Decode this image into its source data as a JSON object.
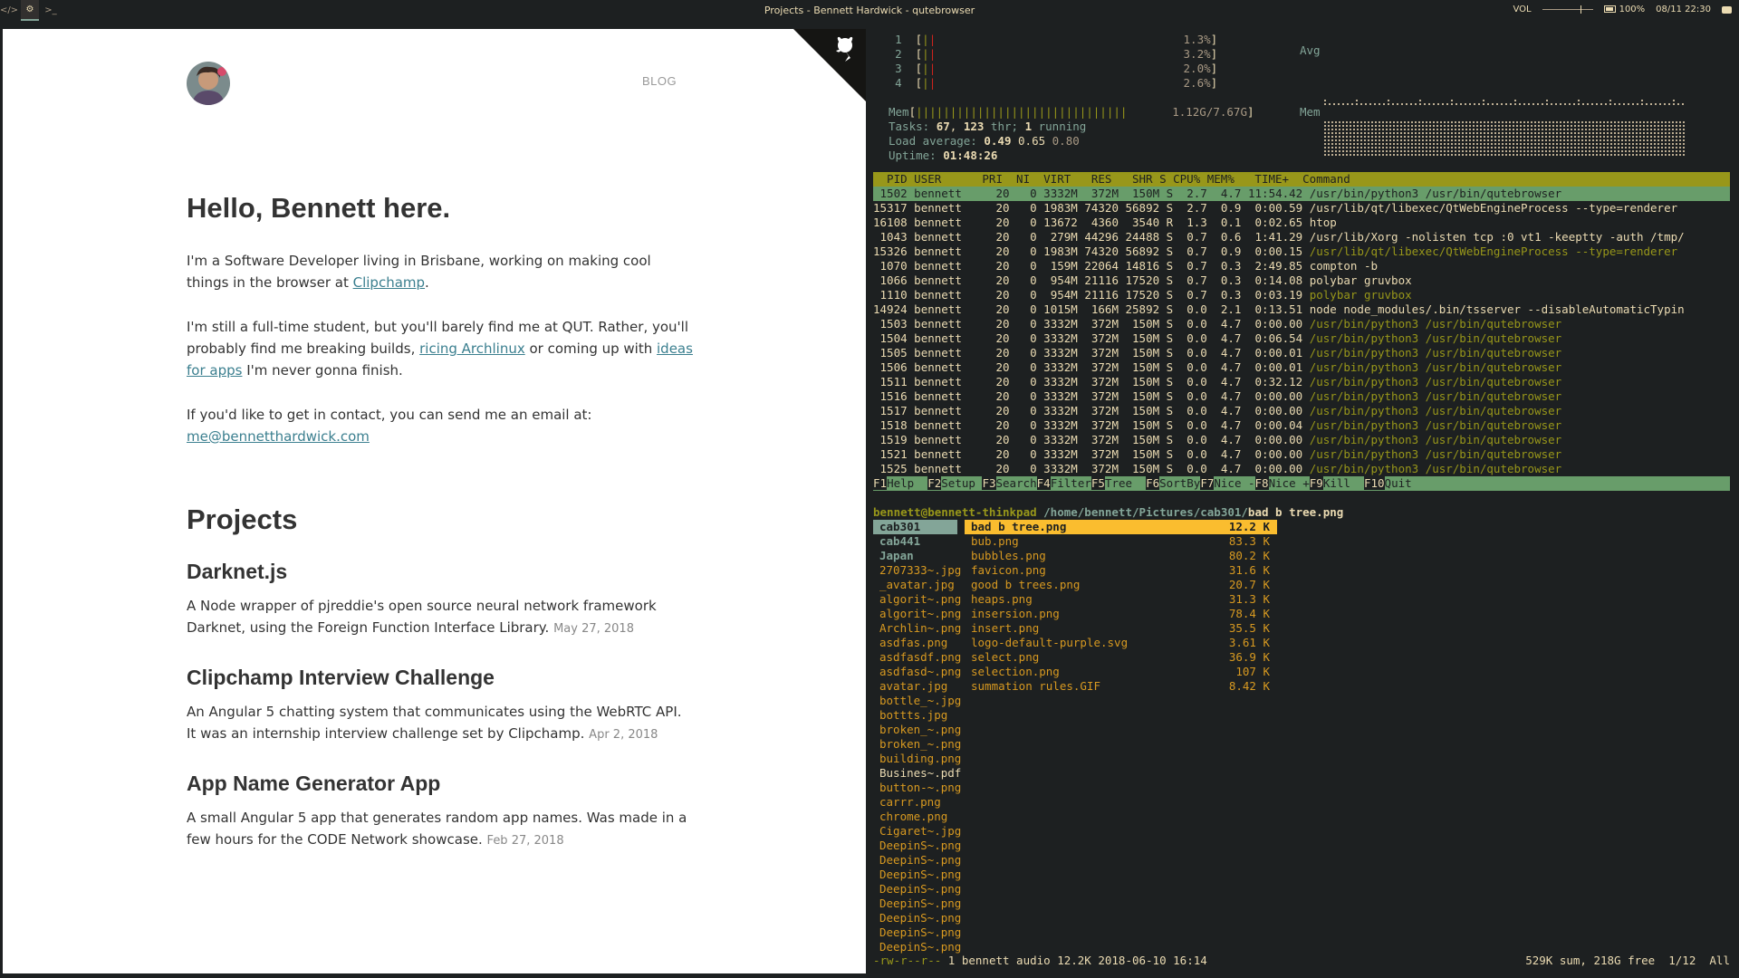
{
  "topbar": {
    "workspaces": [
      "</>",
      "⚙",
      ">_"
    ],
    "window_title": "Projects - Bennett Hardwick - qutebrowser",
    "volume_label": "VOL",
    "volume_level": 0.75,
    "battery": "100%",
    "datetime": "08/11 22:30"
  },
  "browser": {
    "nav_blog": "BLOG",
    "heading": "Hello, Bennett here.",
    "intro_1a": "I'm a Software Developer living in Brisbane, working on making cool things in the browser at ",
    "intro_1_link": "Clipchamp",
    "intro_1b": ".",
    "intro_2a": "I'm still a full-time student, but you'll barely find me at QUT. Rather, you'll probably find me breaking builds, ",
    "intro_2_link1": "ricing Archlinux",
    "intro_2b": " or coming up with ",
    "intro_2_link2": "ideas for apps",
    "intro_2c": " I'm never gonna finish.",
    "contact_text": "If you'd like to get in contact, you can send me an email at:",
    "contact_email": "me@bennetthardwick.com",
    "projects_heading": "Projects",
    "projects": [
      {
        "title": "Darknet.js",
        "desc": "A Node wrapper of pjreddie's open source neural network framework Darknet, using the Foreign Function Interface Library.",
        "date": "May 27, 2018"
      },
      {
        "title": "Clipchamp Interview Challenge",
        "desc": "An Angular 5 chatting system that communicates using the WebRTC API. It was an internship interview challenge set by Clipchamp.",
        "date": "Apr 2, 2018"
      },
      {
        "title": "App Name Generator App",
        "desc": "A small Angular 5 app that generates random app names. Was made in a few hours for the CODE Network showcase.",
        "date": "Feb 27, 2018"
      }
    ]
  },
  "htop": {
    "cpus": [
      {
        "id": "1",
        "pct": "1.3%"
      },
      {
        "id": "2",
        "pct": "3.2%"
      },
      {
        "id": "3",
        "pct": "2.0%"
      },
      {
        "id": "4",
        "pct": "2.6%"
      }
    ],
    "mem_label": "Mem",
    "mem_value": "1.12G/7.67G",
    "avg_label": "Avg",
    "mem_graph_label": "Mem",
    "tasks_label": "Tasks:",
    "tasks_count": "67",
    "tasks_thr": "123",
    "tasks_thr_label": "thr;",
    "tasks_running": "1",
    "tasks_running_label": "running",
    "load_label": "Load average:",
    "load_1": "0.49",
    "load_5": "0.65",
    "load_15": "0.80",
    "uptime_label": "Uptime:",
    "uptime": "01:48:26",
    "header": "  PID USER      PRI  NI  VIRT   RES   SHR S CPU% MEM%   TIME+  Command",
    "rows": [
      {
        "pid": "1502",
        "user": "bennett",
        "pri": "20",
        "ni": "0",
        "virt": "3332M",
        "res": "372M",
        "shr": "150M",
        "s": "S",
        "cpu": "2.7",
        "mem": "4.7",
        "time": "11:54.42",
        "cmd": "/usr/bin/python3 /usr/bin/qutebrowser",
        "sel": true,
        "thread": false
      },
      {
        "pid": "15317",
        "user": "bennett",
        "pri": "20",
        "ni": "0",
        "virt": "1983M",
        "res": "74320",
        "shr": "56892",
        "s": "S",
        "cpu": "2.7",
        "mem": "0.9",
        "time": "0:00.59",
        "cmd": "/usr/lib/qt/libexec/QtWebEngineProcess --type=renderer",
        "sel": false,
        "thread": false
      },
      {
        "pid": "16108",
        "user": "bennett",
        "pri": "20",
        "ni": "0",
        "virt": "13672",
        "res": "4360",
        "shr": "3540",
        "s": "R",
        "cpu": "1.3",
        "mem": "0.1",
        "time": "0:02.65",
        "cmd": "htop",
        "sel": false,
        "thread": false
      },
      {
        "pid": "1043",
        "user": "bennett",
        "pri": "20",
        "ni": "0",
        "virt": "279M",
        "res": "44296",
        "shr": "24488",
        "s": "S",
        "cpu": "0.7",
        "mem": "0.6",
        "time": "1:41.29",
        "cmd": "/usr/lib/Xorg -nolisten tcp :0 vt1 -keeptty -auth /tmp/",
        "sel": false,
        "thread": false
      },
      {
        "pid": "15326",
        "user": "bennett",
        "pri": "20",
        "ni": "0",
        "virt": "1983M",
        "res": "74320",
        "shr": "56892",
        "s": "S",
        "cpu": "0.7",
        "mem": "0.9",
        "time": "0:00.15",
        "cmd": "/usr/lib/qt/libexec/QtWebEngineProcess --type=renderer",
        "sel": false,
        "thread": true
      },
      {
        "pid": "1070",
        "user": "bennett",
        "pri": "20",
        "ni": "0",
        "virt": "159M",
        "res": "22064",
        "shr": "14816",
        "s": "S",
        "cpu": "0.7",
        "mem": "0.3",
        "time": "2:49.85",
        "cmd": "compton -b",
        "sel": false,
        "thread": false
      },
      {
        "pid": "1066",
        "user": "bennett",
        "pri": "20",
        "ni": "0",
        "virt": "954M",
        "res": "21116",
        "shr": "17520",
        "s": "S",
        "cpu": "0.7",
        "mem": "0.3",
        "time": "0:14.08",
        "cmd": "polybar gruvbox",
        "sel": false,
        "thread": false
      },
      {
        "pid": "1110",
        "user": "bennett",
        "pri": "20",
        "ni": "0",
        "virt": "954M",
        "res": "21116",
        "shr": "17520",
        "s": "S",
        "cpu": "0.7",
        "mem": "0.3",
        "time": "0:03.19",
        "cmd": "polybar gruvbox",
        "sel": false,
        "thread": true
      },
      {
        "pid": "14924",
        "user": "bennett",
        "pri": "20",
        "ni": "0",
        "virt": "1015M",
        "res": "166M",
        "shr": "25892",
        "s": "S",
        "cpu": "0.0",
        "mem": "2.1",
        "time": "0:13.51",
        "cmd": "node node_modules/.bin/tsserver --disableAutomaticTypin",
        "sel": false,
        "thread": false
      },
      {
        "pid": "1503",
        "user": "bennett",
        "pri": "20",
        "ni": "0",
        "virt": "3332M",
        "res": "372M",
        "shr": "150M",
        "s": "S",
        "cpu": "0.0",
        "mem": "4.7",
        "time": "0:00.00",
        "cmd": "/usr/bin/python3 /usr/bin/qutebrowser",
        "sel": false,
        "thread": true
      },
      {
        "pid": "1504",
        "user": "bennett",
        "pri": "20",
        "ni": "0",
        "virt": "3332M",
        "res": "372M",
        "shr": "150M",
        "s": "S",
        "cpu": "0.0",
        "mem": "4.7",
        "time": "0:06.54",
        "cmd": "/usr/bin/python3 /usr/bin/qutebrowser",
        "sel": false,
        "thread": true
      },
      {
        "pid": "1505",
        "user": "bennett",
        "pri": "20",
        "ni": "0",
        "virt": "3332M",
        "res": "372M",
        "shr": "150M",
        "s": "S",
        "cpu": "0.0",
        "mem": "4.7",
        "time": "0:00.01",
        "cmd": "/usr/bin/python3 /usr/bin/qutebrowser",
        "sel": false,
        "thread": true
      },
      {
        "pid": "1506",
        "user": "bennett",
        "pri": "20",
        "ni": "0",
        "virt": "3332M",
        "res": "372M",
        "shr": "150M",
        "s": "S",
        "cpu": "0.0",
        "mem": "4.7",
        "time": "0:00.01",
        "cmd": "/usr/bin/python3 /usr/bin/qutebrowser",
        "sel": false,
        "thread": true
      },
      {
        "pid": "1511",
        "user": "bennett",
        "pri": "20",
        "ni": "0",
        "virt": "3332M",
        "res": "372M",
        "shr": "150M",
        "s": "S",
        "cpu": "0.0",
        "mem": "4.7",
        "time": "0:32.12",
        "cmd": "/usr/bin/python3 /usr/bin/qutebrowser",
        "sel": false,
        "thread": true
      },
      {
        "pid": "1516",
        "user": "bennett",
        "pri": "20",
        "ni": "0",
        "virt": "3332M",
        "res": "372M",
        "shr": "150M",
        "s": "S",
        "cpu": "0.0",
        "mem": "4.7",
        "time": "0:00.00",
        "cmd": "/usr/bin/python3 /usr/bin/qutebrowser",
        "sel": false,
        "thread": true
      },
      {
        "pid": "1517",
        "user": "bennett",
        "pri": "20",
        "ni": "0",
        "virt": "3332M",
        "res": "372M",
        "shr": "150M",
        "s": "S",
        "cpu": "0.0",
        "mem": "4.7",
        "time": "0:00.00",
        "cmd": "/usr/bin/python3 /usr/bin/qutebrowser",
        "sel": false,
        "thread": true
      },
      {
        "pid": "1518",
        "user": "bennett",
        "pri": "20",
        "ni": "0",
        "virt": "3332M",
        "res": "372M",
        "shr": "150M",
        "s": "S",
        "cpu": "0.0",
        "mem": "4.7",
        "time": "0:00.04",
        "cmd": "/usr/bin/python3 /usr/bin/qutebrowser",
        "sel": false,
        "thread": true
      },
      {
        "pid": "1519",
        "user": "bennett",
        "pri": "20",
        "ni": "0",
        "virt": "3332M",
        "res": "372M",
        "shr": "150M",
        "s": "S",
        "cpu": "0.0",
        "mem": "4.7",
        "time": "0:00.00",
        "cmd": "/usr/bin/python3 /usr/bin/qutebrowser",
        "sel": false,
        "thread": true
      },
      {
        "pid": "1521",
        "user": "bennett",
        "pri": "20",
        "ni": "0",
        "virt": "3332M",
        "res": "372M",
        "shr": "150M",
        "s": "S",
        "cpu": "0.0",
        "mem": "4.7",
        "time": "0:00.00",
        "cmd": "/usr/bin/python3 /usr/bin/qutebrowser",
        "sel": false,
        "thread": true
      },
      {
        "pid": "1525",
        "user": "bennett",
        "pri": "20",
        "ni": "0",
        "virt": "3332M",
        "res": "372M",
        "shr": "150M",
        "s": "S",
        "cpu": "0.0",
        "mem": "4.7",
        "time": "0:00.00",
        "cmd": "/usr/bin/python3 /usr/bin/qutebrowser",
        "sel": false,
        "thread": true
      }
    ],
    "fkeys": [
      {
        "key": "F1",
        "label": "Help  "
      },
      {
        "key": "F2",
        "label": "Setup "
      },
      {
        "key": "F3",
        "label": "Search"
      },
      {
        "key": "F4",
        "label": "Filter"
      },
      {
        "key": "F5",
        "label": "Tree  "
      },
      {
        "key": "F6",
        "label": "SortBy"
      },
      {
        "key": "F7",
        "label": "Nice -"
      },
      {
        "key": "F8",
        "label": "Nice +"
      },
      {
        "key": "F9",
        "label": "Kill  "
      },
      {
        "key": "F10",
        "label": "Quit  "
      }
    ]
  },
  "ranger": {
    "user_host": "bennett@bennett-thinkpad",
    "path": " /home/bennett/Pictures/cab301/",
    "file": "bad b tree.png",
    "left": [
      {
        "name": "cab301",
        "type": "sel"
      },
      {
        "name": "cab441",
        "type": "dir"
      },
      {
        "name": "Japan",
        "type": "dir"
      },
      {
        "name": "2707333~.jpg",
        "type": "file"
      },
      {
        "name": "_avatar.jpg",
        "type": "file"
      },
      {
        "name": "algorit~.png",
        "type": "file"
      },
      {
        "name": "algorit~.png",
        "type": "file"
      },
      {
        "name": "Archlin~.png",
        "type": "file"
      },
      {
        "name": "asdfas.png",
        "type": "file"
      },
      {
        "name": "asdfasdf.png",
        "type": "file"
      },
      {
        "name": "asdfasd~.png",
        "type": "file"
      },
      {
        "name": "avatar.jpg",
        "type": "file"
      },
      {
        "name": "bottle_~.jpg",
        "type": "file"
      },
      {
        "name": "bottts.jpg",
        "type": "file"
      },
      {
        "name": "broken_~.png",
        "type": "file"
      },
      {
        "name": "broken_~.png",
        "type": "file"
      },
      {
        "name": "building.png",
        "type": "file"
      },
      {
        "name": "Busines~.pdf",
        "type": "white"
      },
      {
        "name": "button-~.png",
        "type": "file"
      },
      {
        "name": "carrr.png",
        "type": "file"
      },
      {
        "name": "chrome.png",
        "type": "file"
      },
      {
        "name": "Cigaret~.jpg",
        "type": "file"
      },
      {
        "name": "DeepinS~.png",
        "type": "file"
      },
      {
        "name": "DeepinS~.png",
        "type": "file"
      },
      {
        "name": "DeepinS~.png",
        "type": "file"
      },
      {
        "name": "DeepinS~.png",
        "type": "file"
      },
      {
        "name": "DeepinS~.png",
        "type": "file"
      },
      {
        "name": "DeepinS~.png",
        "type": "file"
      },
      {
        "name": "DeepinS~.png",
        "type": "file"
      },
      {
        "name": "DeepinS~.png",
        "type": "file"
      }
    ],
    "right": [
      {
        "name": "bad b tree.png",
        "size": "12.2 K",
        "sel": true
      },
      {
        "name": "bub.png",
        "size": "83.3 K",
        "sel": false
      },
      {
        "name": "bubbles.png",
        "size": "80.2 K",
        "sel": false
      },
      {
        "name": "favicon.png",
        "size": "31.6 K",
        "sel": false
      },
      {
        "name": "good b trees.png",
        "size": "20.7 K",
        "sel": false
      },
      {
        "name": "heaps.png",
        "size": "31.3 K",
        "sel": false
      },
      {
        "name": "insersion.png",
        "size": "78.4 K",
        "sel": false
      },
      {
        "name": "insert.png",
        "size": "35.5 K",
        "sel": false
      },
      {
        "name": "logo-default-purple.svg",
        "size": "3.61 K",
        "sel": false
      },
      {
        "name": "select.png",
        "size": "36.9 K",
        "sel": false
      },
      {
        "name": "selection.png",
        "size": "107 K",
        "sel": false
      },
      {
        "name": "summation rules.GIF",
        "size": "8.42 K",
        "sel": false
      }
    ],
    "status_perm": "-rw-r--r--",
    "status_info": " 1 bennett audio 12.2K 2018-06-10 16:14",
    "status_right": "529K sum, 218G free  1/12  All"
  },
  "colors": {
    "accent_green": "#98971a",
    "accent_aqua": "#689d6a",
    "accent_blue": "#83a598",
    "accent_yellow": "#fabd2f",
    "bg": "#1d2021",
    "fg": "#ebdbb2",
    "link": "#3b7f8f"
  }
}
